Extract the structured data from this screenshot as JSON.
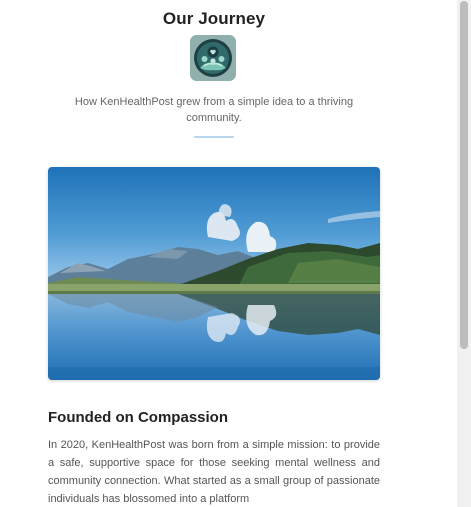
{
  "header": {
    "title": "Our Journey",
    "logo_icon": "heart-hands-community-logo",
    "subtitle": "How KenHealthPost grew from a simple idea to a thriving community."
  },
  "hero_image": {
    "description_icon": "mountain-lake-reflection-image"
  },
  "section": {
    "heading": "Founded on Compassion",
    "body": "In 2020, KenHealthPost was born from a simple mission: to provide a safe, supportive space for those seeking mental wellness and community connection. What started as a small group of passionate individuals has blossomed into a platform"
  },
  "colors": {
    "accent_divider": "#b7d6ee",
    "title_text": "#222222",
    "body_text": "#555555"
  }
}
